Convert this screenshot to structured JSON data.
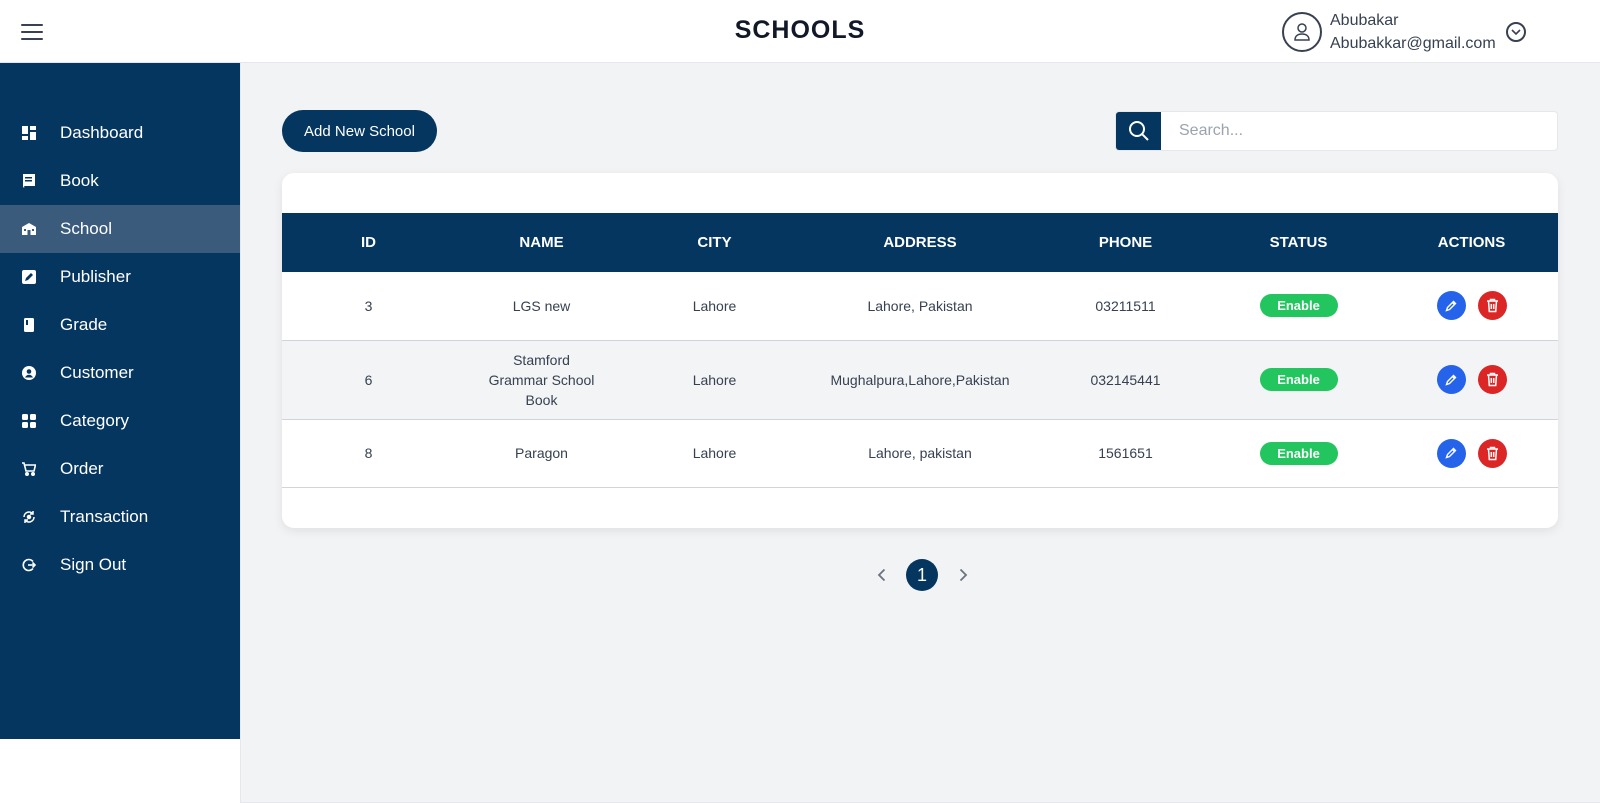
{
  "header": {
    "title": "SCHOOLS",
    "user_name": "Abubakar",
    "user_email": "Abubakkar@gmail.com"
  },
  "sidebar": {
    "items": [
      {
        "label": "Dashboard",
        "icon": "dashboard-icon"
      },
      {
        "label": "Book",
        "icon": "book-icon"
      },
      {
        "label": "School",
        "icon": "school-icon",
        "active": true
      },
      {
        "label": "Publisher",
        "icon": "publisher-icon"
      },
      {
        "label": "Grade",
        "icon": "grade-icon"
      },
      {
        "label": "Customer",
        "icon": "customer-icon"
      },
      {
        "label": "Category",
        "icon": "category-icon"
      },
      {
        "label": "Order",
        "icon": "cart-icon"
      },
      {
        "label": "Transaction",
        "icon": "transaction-icon"
      },
      {
        "label": "Sign Out",
        "icon": "sign-out-icon"
      }
    ]
  },
  "toolbar": {
    "add_label": "Add New School",
    "search_placeholder": "Search..."
  },
  "table": {
    "headers": [
      "ID",
      "NAME",
      "CITY",
      "ADDRESS",
      "PHONE",
      "STATUS",
      "ACTIONS"
    ],
    "rows": [
      {
        "id": "3",
        "name": "LGS new",
        "city": "Lahore",
        "address": "Lahore, Pakistan",
        "phone": "03211511",
        "status": "Enable"
      },
      {
        "id": "6",
        "name": "Stamford Grammar School Book",
        "city": "Lahore",
        "address": "Mughalpura,Lahore,Pakistan",
        "phone": "032145441",
        "status": "Enable"
      },
      {
        "id": "8",
        "name": "Paragon",
        "city": "Lahore",
        "address": "Lahore, pakistan",
        "phone": "1561651",
        "status": "Enable"
      }
    ]
  },
  "pagination": {
    "current_page": "1"
  },
  "colors": {
    "brand": "#05365f",
    "active_nav": "#3a5b7c",
    "status_enable": "#22c55e",
    "edit": "#2563eb",
    "delete": "#dc2626"
  }
}
